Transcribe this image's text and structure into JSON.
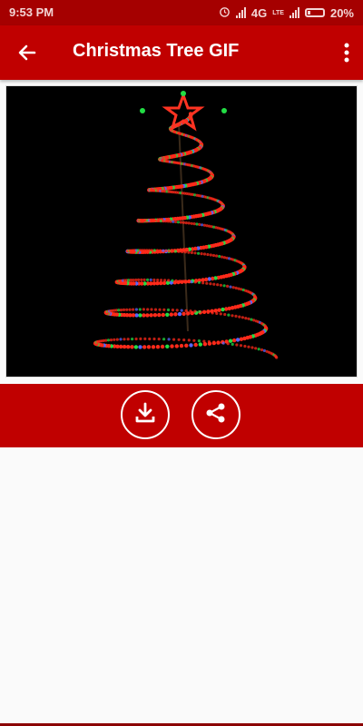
{
  "status_bar": {
    "time": "9:53 PM",
    "network": "4G",
    "network2": "LTE",
    "battery": "20%"
  },
  "app_bar": {
    "title": "Christmas Tree GIF",
    "back_icon": "arrow-left-icon",
    "menu_icon": "more-vert-icon"
  },
  "content": {
    "image": "christmas-tree-gif"
  },
  "actions": {
    "download_icon": "download-icon",
    "share_icon": "share-icon"
  },
  "colors": {
    "primary": "#c00000",
    "status": "#a50000"
  }
}
